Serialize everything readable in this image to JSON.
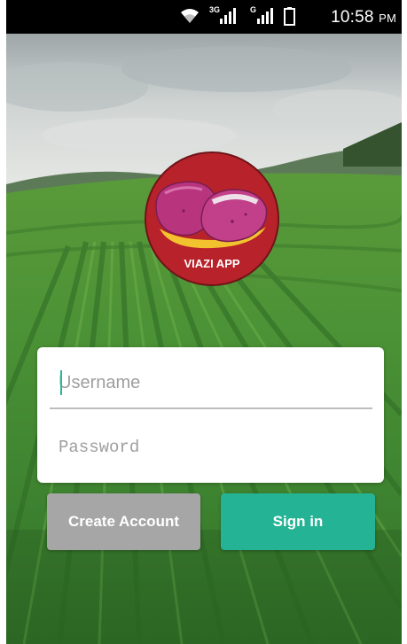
{
  "status_bar": {
    "time": "10:58",
    "ampm": "PM",
    "network_1_label": "3G",
    "network_2_label": "G",
    "icons": [
      "wifi-icon",
      "signal-3g-icon",
      "signal-g-icon",
      "battery-icon"
    ]
  },
  "logo": {
    "text": "VIAZI APP"
  },
  "login": {
    "username_placeholder": "Username",
    "username_value": "",
    "password_placeholder": "Password",
    "password_value": ""
  },
  "buttons": {
    "create_account_label": "Create Account",
    "sign_in_label": "Sign in"
  },
  "colors": {
    "status_bar": "#000000",
    "sign_in_button": "#24b394",
    "create_account_button": "#a6a6a6",
    "logo_circle": "#b8222a",
    "potato": "#b8357d",
    "field_green": "#3f8a2e"
  }
}
